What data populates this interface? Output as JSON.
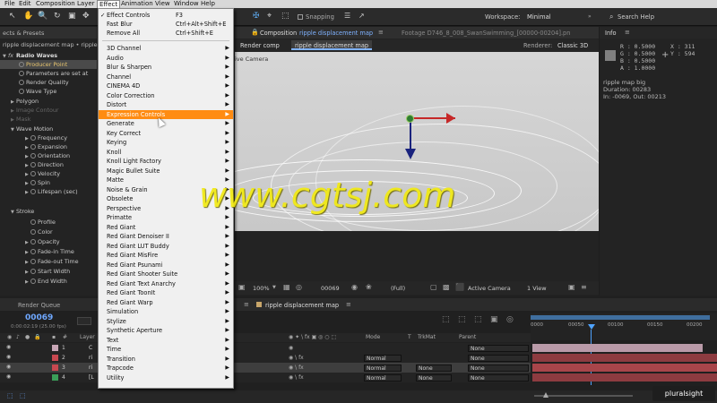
{
  "menubar": {
    "items": [
      "File",
      "Edit",
      "Composition",
      "Layer",
      "Effect",
      "Animation",
      "View",
      "Window",
      "Help"
    ],
    "active": "Effect"
  },
  "toolbar": {
    "snapping": "Snapping",
    "workspace_label": "Workspace:",
    "workspace_value": "Minimal",
    "search_help": "Search Help"
  },
  "effect_panel": {
    "tab": "ects & Presets",
    "breadcrumb": "ripple displacement map • ripple",
    "rows": [
      {
        "label": "Radio Waves",
        "level": 0
      },
      {
        "label": "Producer Point",
        "level": 1
      },
      {
        "label": "Parameters are set at",
        "level": 1
      },
      {
        "label": "Render Quality",
        "level": 1
      },
      {
        "label": "Wave Type",
        "level": 1
      },
      {
        "label": "Polygon",
        "level": 0
      },
      {
        "label": "Image Contour",
        "level": 0
      },
      {
        "label": "Mask",
        "level": 0
      },
      {
        "label": "Wave Motion",
        "level": 0
      },
      {
        "label": "Frequency",
        "level": 2
      },
      {
        "label": "Expansion",
        "level": 2
      },
      {
        "label": "Orientation",
        "level": 2
      },
      {
        "label": "Direction",
        "level": 2
      },
      {
        "label": "Velocity",
        "level": 2
      },
      {
        "label": "Spin",
        "level": 2
      },
      {
        "label": "Lifespan (sec)",
        "level": 2
      },
      {
        "label": "Stroke",
        "level": 0
      },
      {
        "label": "Profile",
        "level": 2
      },
      {
        "label": "Color",
        "level": 2
      },
      {
        "label": "Opacity",
        "level": 2
      },
      {
        "label": "Fade-in Time",
        "level": 2
      },
      {
        "label": "Fade-out Time",
        "level": 2
      },
      {
        "label": "Start Width",
        "level": 2
      },
      {
        "label": "End Width",
        "level": 2
      }
    ]
  },
  "effect_menu": {
    "items": [
      {
        "label": "Effect Controls",
        "shortcut": "F3",
        "check": true
      },
      {
        "label": "Fast Blur",
        "shortcut": "Ctrl+Alt+Shift+E"
      },
      {
        "label": "Remove All",
        "shortcut": "Ctrl+Shift+E"
      },
      {
        "sep": true
      },
      {
        "label": "3D Channel",
        "sub": true
      },
      {
        "label": "Audio",
        "sub": true
      },
      {
        "label": "Blur & Sharpen",
        "sub": true
      },
      {
        "label": "Channel",
        "sub": true
      },
      {
        "label": "CINEMA 4D",
        "sub": true
      },
      {
        "label": "Color Correction",
        "sub": true
      },
      {
        "label": "Distort",
        "sub": true
      },
      {
        "label": "Expression Controls",
        "sub": true,
        "highlight": true
      },
      {
        "label": "Generate",
        "sub": true
      },
      {
        "label": "Key Correct",
        "sub": true
      },
      {
        "label": "Keying",
        "sub": true
      },
      {
        "label": "Knoll",
        "sub": true
      },
      {
        "label": "Knoll Light Factory",
        "sub": true
      },
      {
        "label": "Magic Bullet Suite",
        "sub": true
      },
      {
        "label": "Matte",
        "sub": true
      },
      {
        "label": "Noise & Grain",
        "sub": true
      },
      {
        "label": "Obsolete",
        "sub": true
      },
      {
        "label": "Perspective",
        "sub": true
      },
      {
        "label": "Primatte",
        "sub": true
      },
      {
        "label": "Red Giant",
        "sub": true
      },
      {
        "label": "Red Giant Denoiser II",
        "sub": true
      },
      {
        "label": "Red Giant LUT Buddy",
        "sub": true
      },
      {
        "label": "Red Giant MisFire",
        "sub": true
      },
      {
        "label": "Red Giant Psunami",
        "sub": true
      },
      {
        "label": "Red Giant Shooter Suite",
        "sub": true
      },
      {
        "label": "Red Giant Text Anarchy",
        "sub": true
      },
      {
        "label": "Red Giant ToonIt",
        "sub": true
      },
      {
        "label": "Red Giant Warp",
        "sub": true
      },
      {
        "label": "Simulation",
        "sub": true
      },
      {
        "label": "Stylize",
        "sub": true
      },
      {
        "label": "Synthetic Aperture",
        "sub": true
      },
      {
        "label": "Text",
        "sub": true
      },
      {
        "label": "Time",
        "sub": true
      },
      {
        "label": "Transition",
        "sub": true
      },
      {
        "label": "Trapcode",
        "sub": true
      },
      {
        "label": "Utility",
        "sub": true
      }
    ]
  },
  "composition": {
    "tab_prefix": "Composition",
    "tab_name": "ripple displacement map",
    "footage_tab": "Footage D746_8_008_SwanSwimming_[00000-00204].pn",
    "sub_tab_1": "Render comp",
    "sub_tab_2": "ripple displacement map",
    "renderer_label": "Renderer:",
    "renderer_value": "Classic 3D",
    "camera_label": "ive Camera",
    "footer": {
      "zoom": "100%",
      "frame": "00069",
      "quality": "(Full)",
      "camera": "Active Camera",
      "view": "1 View"
    }
  },
  "info": {
    "title": "Info",
    "r": "R : 0.5000",
    "g": "G : 0.5000",
    "b": "B : 0.5000",
    "a": "A : 1.0000",
    "x": "X : 311",
    "y": "Y : 594",
    "comp_name": "ripple map big",
    "duration": "Duration: 00283",
    "inout": "In: -0069, Out: 00213"
  },
  "timeline": {
    "render_queue": "Render Queue",
    "comp_tab": "ripple displacement map",
    "timecode": "00069",
    "timecode_sub": "0:00:02:19 (25.00 fps)",
    "col_hash": "#",
    "col_layer": "Layer",
    "col_mode": "Mode",
    "col_t": "T",
    "col_trkmat": "TrkMat",
    "col_parent": "Parent",
    "ruler": [
      "0000",
      "00050",
      "00100",
      "00150",
      "00200"
    ],
    "layers": [
      {
        "num": "1",
        "name": "C",
        "color": "#c8a6b6",
        "mode": "",
        "trkmat": "",
        "parent": "None"
      },
      {
        "num": "2",
        "name": "ri",
        "color": "#c84850",
        "mode": "Normal",
        "trkmat": "",
        "parent": "None"
      },
      {
        "num": "3",
        "name": "ri",
        "color": "#c84850",
        "mode": "Normal",
        "trkmat": "None",
        "parent": "None"
      },
      {
        "num": "4",
        "name": "[L",
        "color": "#3a9e58",
        "mode": "Normal",
        "trkmat": "None",
        "parent": "None"
      }
    ]
  },
  "watermark": {
    "site": "www.cgtsj.com",
    "brand": "pluralsight"
  }
}
